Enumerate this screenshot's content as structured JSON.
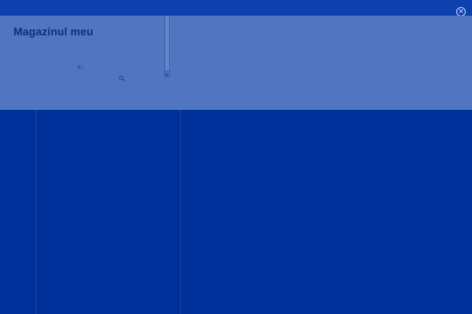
{
  "header": {
    "store_title": "Magazinul meu"
  },
  "icons": {
    "close": "close-icon",
    "search": "search-icon",
    "bars": "bars-icon"
  },
  "colors": {
    "background": "#00319b",
    "header_panel": "#5275c0",
    "title": "#0d2e83"
  }
}
